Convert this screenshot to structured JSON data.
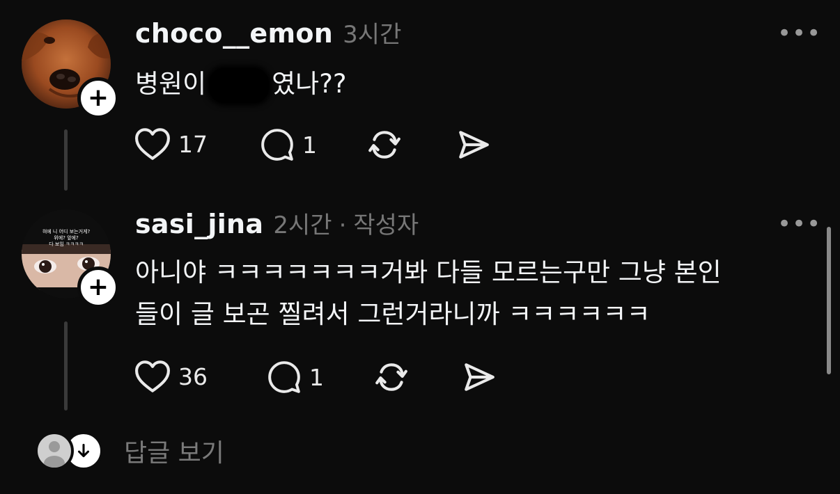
{
  "comments": [
    {
      "username": "choco__emon",
      "time": "3시간",
      "author_badge": "",
      "text_before": "병원이",
      "text_after": "였나??",
      "likes": "17",
      "replies": "1",
      "avatar": "dog-photo"
    },
    {
      "username": "sasi_jina",
      "time": "2시간",
      "separator": "·",
      "author_badge": "작성자",
      "text_line1": "아니야 ㅋㅋㅋㅋㅋㅋㅋ거봐 다들 모르는구만 그냥 본인",
      "text_line2": "들이 글 보곤 찔려서 그런거라니까 ㅋㅋㅋㅋㅋㅋ",
      "likes": "36",
      "replies": "1",
      "avatar": "girl-eyes-photo",
      "avatar_caption": [
        "혀에 니 어디 보는거게?",
        "위에? 앞에?",
        "다 보임 ㅋㅋㅋㅋ"
      ]
    }
  ],
  "more_label": "•••",
  "follow_label": "+",
  "view_replies_label": "답글 보기",
  "icons": [
    "heart-icon",
    "comment-icon",
    "repost-icon",
    "share-icon",
    "more-icon",
    "arrow-down-icon"
  ],
  "colors": {
    "background": "#0c0c0c",
    "text": "#f3f5f7",
    "muted": "#777777"
  }
}
